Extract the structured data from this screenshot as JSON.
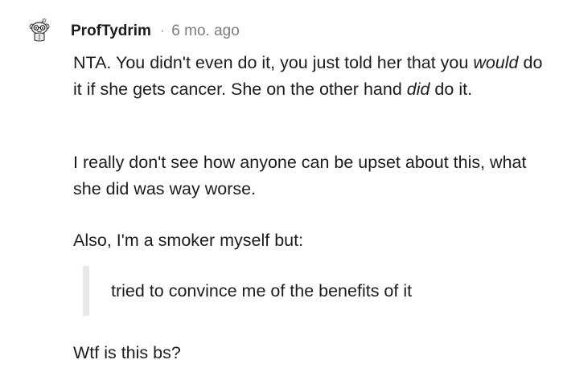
{
  "comment": {
    "author": "ProfTydrim",
    "separator": "·",
    "time": "6 mo. ago",
    "avatar_icon": "reddit-snoo-avatar-icon",
    "p1": {
      "a": "NTA. You didn't even do it, you just told her that you ",
      "b": "would",
      "c": " do it if she gets cancer. She on the other hand ",
      "d": "did",
      "e": " do it."
    },
    "p2": "I really don't see how anyone can be upset about this, what she did was way worse.",
    "p3": "Also, I'm a smoker myself but:",
    "quote": "tried to convince me of the benefits of it",
    "p4": "Wtf is this bs?"
  },
  "colors": {
    "text": "#1c1c1c",
    "meta": "#7c7c7c",
    "quote_bar": "#e8e8e8",
    "background": "#ffffff"
  }
}
